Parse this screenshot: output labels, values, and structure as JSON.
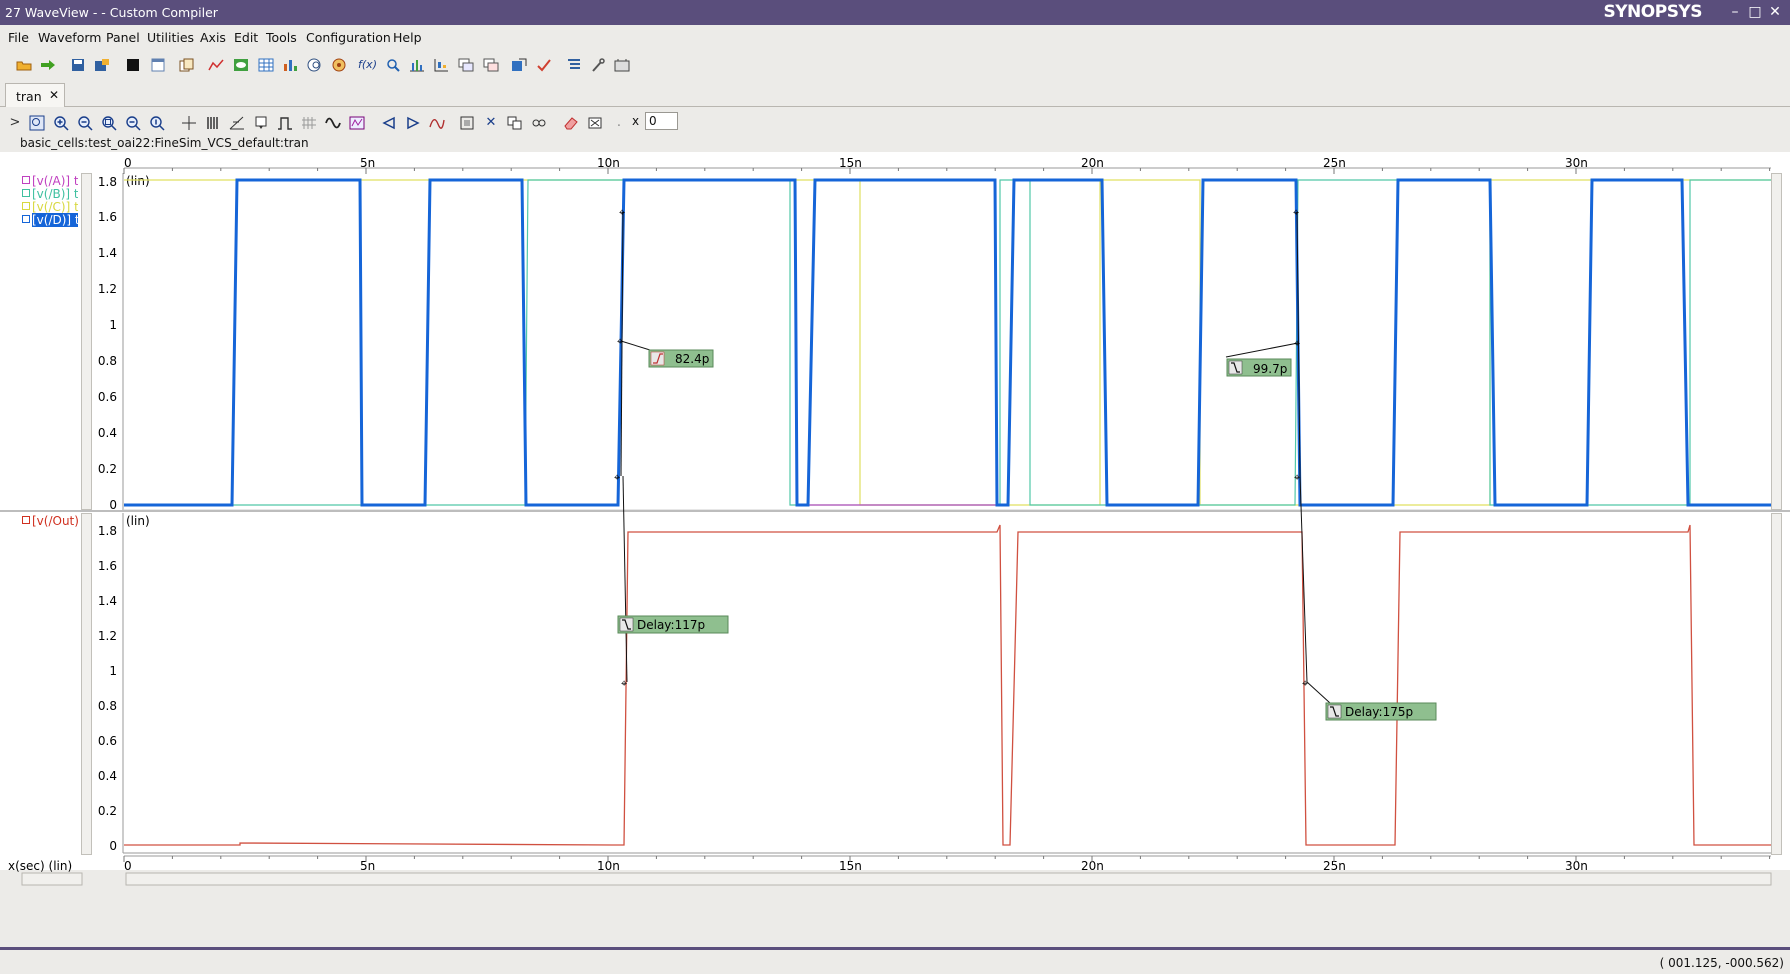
{
  "window": {
    "title": "27 WaveView -  - Custom Compiler",
    "brand": "SYNOPSYS",
    "controls": [
      "–",
      "□",
      "✕"
    ]
  },
  "menu": [
    "File",
    "Waveform",
    "Panel",
    "Utilities",
    "Axis",
    "Edit",
    "Tools",
    "Configuration",
    "Help"
  ],
  "tab": {
    "label": "tran",
    "close": "✕"
  },
  "x_field": {
    "label": "x",
    "value": "0"
  },
  "design_path": "basic_cells:test_oai22:FineSim_VCS_default:tran",
  "top_panel": {
    "scale_label": "(lin)",
    "legend": [
      {
        "label": "[v(/A)] t",
        "color": "#c040c0"
      },
      {
        "label": "[v(/B)] t",
        "color": "#40c0a0"
      },
      {
        "label": "[v(/C)] t",
        "color": "#d8d840"
      },
      {
        "label": "[v(/D)] t",
        "color": "#ffffff"
      }
    ],
    "y_ticks": [
      "1.8",
      "1.6",
      "1.4",
      "1.2",
      "1",
      "0.8",
      "0.6",
      "0.4",
      "0.2",
      "0"
    ],
    "annotations": [
      {
        "text": "82.4p",
        "type": "rise"
      },
      {
        "text": "99.7p",
        "type": "fall"
      }
    ]
  },
  "bottom_panel": {
    "scale_label": "(lin)",
    "legend": [
      {
        "label": "[v(/Out)]",
        "color": "#d03020"
      }
    ],
    "y_ticks": [
      "1.8",
      "1.6",
      "1.4",
      "1.2",
      "1",
      "0.8",
      "0.6",
      "0.4",
      "0.2",
      "0"
    ],
    "annotations": [
      {
        "text": "Delay:117p"
      },
      {
        "text": "Delay:175p"
      }
    ]
  },
  "x_axis": {
    "label": "x(sec) (lin)",
    "ticks": [
      "0",
      "5n",
      "10n",
      "15n",
      "20n",
      "25n",
      "30n"
    ]
  },
  "colors": {
    "titlebar": "#5a4e7c",
    "signal_D": "#1565d8",
    "signal_Out": "#d05040",
    "annotation_bg": "#8fbf8f"
  },
  "status": {
    "coords": "( 001.125, -000.562)"
  }
}
